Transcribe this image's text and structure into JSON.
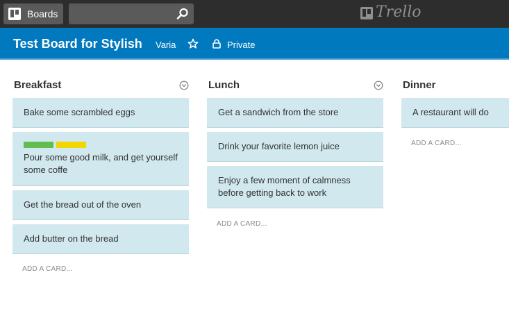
{
  "header": {
    "boards_label": "Boards",
    "search_value": "",
    "logo_text": "Trello"
  },
  "board": {
    "title": "Test Board for Stylish",
    "organization": "Varia",
    "privacy": "Private"
  },
  "lists": [
    {
      "name": "Breakfast",
      "cards": [
        {
          "text": "Bake some scrambled eggs"
        },
        {
          "text": "Pour some good milk, and get yourself some coffe",
          "labels": [
            "#61bd4f",
            "#f2d600"
          ]
        },
        {
          "text": "Get the bread out of the oven"
        },
        {
          "text": "Add butter on the bread"
        }
      ],
      "add_card_label": "ADD A CARD..."
    },
    {
      "name": "Lunch",
      "cards": [
        {
          "text": "Get a sandwich from the store"
        },
        {
          "text": "Drink your favorite lemon juice"
        },
        {
          "text": "Enjoy a few moment of calmness before getting back to work"
        }
      ],
      "add_card_label": "ADD A CARD..."
    },
    {
      "name": "Dinner",
      "cards": [
        {
          "text": "A restaurant will do"
        }
      ],
      "add_card_label": "ADD A CARD..."
    }
  ],
  "colors": {
    "header_bg": "#2d2d2d",
    "board_bar": "#0079bf",
    "card_bg": "#d1e8ee",
    "label_green": "#61bd4f",
    "label_yellow": "#f2d600"
  }
}
